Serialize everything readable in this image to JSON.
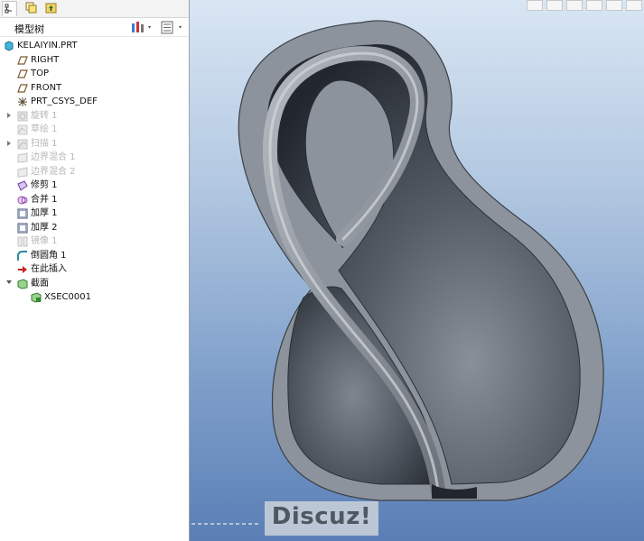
{
  "model_tree": {
    "title": "模型树",
    "root_label": "KELAIYIN.PRT",
    "items": [
      {
        "label": "RIGHT",
        "type": "datum-plane",
        "disabled": false,
        "expander": "none"
      },
      {
        "label": "TOP",
        "type": "datum-plane",
        "disabled": false,
        "expander": "none"
      },
      {
        "label": "FRONT",
        "type": "datum-plane",
        "disabled": false,
        "expander": "none"
      },
      {
        "label": "PRT_CSYS_DEF",
        "type": "csys",
        "disabled": false,
        "expander": "none"
      },
      {
        "label": "旋转 1",
        "type": "revolve",
        "disabled": true,
        "expander": "collapsed"
      },
      {
        "label": "草绘 1",
        "type": "sketch",
        "disabled": true,
        "expander": "none"
      },
      {
        "label": "扫描 1",
        "type": "sweep",
        "disabled": true,
        "expander": "collapsed"
      },
      {
        "label": "边界混合 1",
        "type": "boundary-blend",
        "disabled": true,
        "expander": "none"
      },
      {
        "label": "边界混合 2",
        "type": "boundary-blend",
        "disabled": true,
        "expander": "none"
      },
      {
        "label": "修剪 1",
        "type": "trim",
        "disabled": false,
        "expander": "none"
      },
      {
        "label": "合并 1",
        "type": "merge",
        "disabled": false,
        "expander": "none"
      },
      {
        "label": "加厚 1",
        "type": "thicken",
        "disabled": false,
        "expander": "none"
      },
      {
        "label": "加厚 2",
        "type": "thicken",
        "disabled": false,
        "expander": "none"
      },
      {
        "label": "镜像 1",
        "type": "mirror",
        "disabled": true,
        "expander": "none"
      },
      {
        "label": "倒圆角 1",
        "type": "round",
        "disabled": false,
        "expander": "none"
      },
      {
        "label": "在此插入",
        "type": "insert-here",
        "disabled": false,
        "expander": "none"
      },
      {
        "label": "截面",
        "type": "sections",
        "disabled": false,
        "expander": "expanded"
      },
      {
        "label": "XSEC0001",
        "type": "xsec",
        "disabled": false,
        "expander": "none",
        "indent": true
      }
    ]
  },
  "watermark": {
    "text": "Discuz!"
  },
  "colors": {
    "viewport_top": "#d9e6f4",
    "viewport_bottom": "#5a7fb6",
    "model_grey": "#8d939c",
    "model_dark": "#2a2f36",
    "disabled_text": "#b7b7b7"
  }
}
